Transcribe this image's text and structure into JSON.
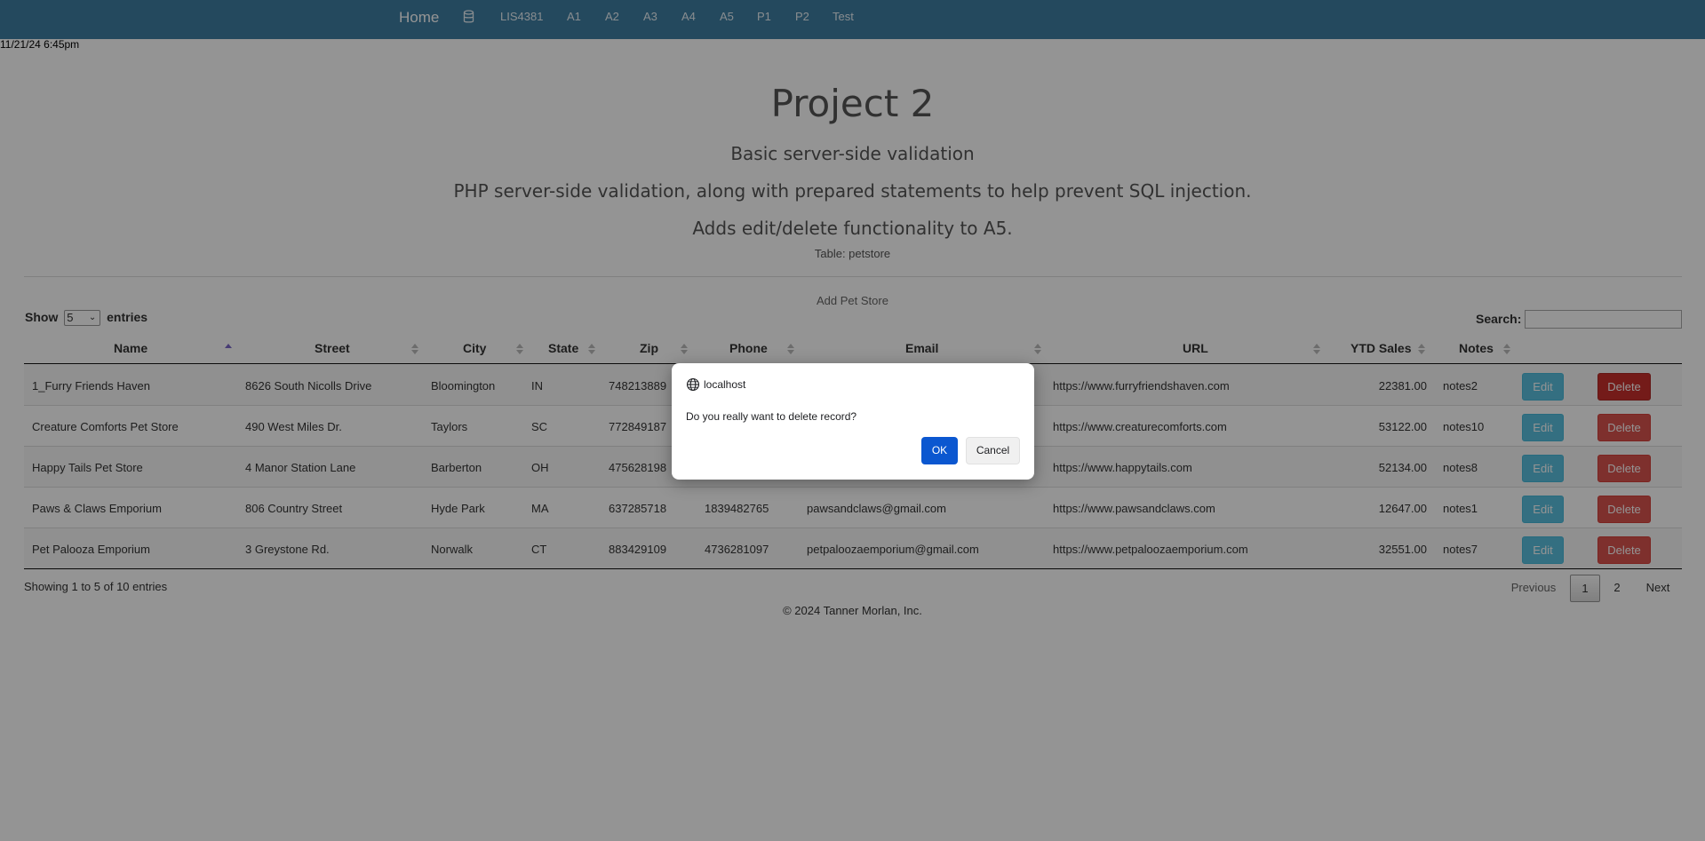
{
  "navbar": {
    "brand": "Home",
    "links": [
      "LIS4381",
      "A1",
      "A2",
      "A3",
      "A4",
      "A5",
      "P1",
      "P2",
      "Test"
    ]
  },
  "timestamp": "11/21/24 6:45pm",
  "header": {
    "title": "Project 2",
    "subtitle1": "Basic server-side validation",
    "subtitle2": "PHP server-side validation, along with prepared statements to help prevent SQL injection.",
    "subtitle3": "Adds edit/delete functionality to A5.",
    "table_name": "Table: petstore"
  },
  "add_link": "Add Pet Store",
  "controls": {
    "show_label": "Show",
    "show_value": "5",
    "entries_label": "entries",
    "search_label": "Search:",
    "search_value": ""
  },
  "table": {
    "columns": [
      "Name",
      "Street",
      "City",
      "State",
      "Zip",
      "Phone",
      "Email",
      "URL",
      "YTD Sales",
      "Notes"
    ],
    "edit_label": "Edit",
    "delete_label": "Delete",
    "rows": [
      {
        "name": "1_Furry Friends Haven",
        "street": "8626 South Nicolls Drive",
        "city": "Bloomington",
        "state": "IN",
        "zip": "748213889",
        "phone": "",
        "email": "",
        "url": "https://www.furryfriendshaven.com",
        "ytd": "22381.00",
        "notes": "notes2"
      },
      {
        "name": "Creature Comforts Pet Store",
        "street": "490 West Miles Dr.",
        "city": "Taylors",
        "state": "SC",
        "zip": "772849187",
        "phone": "",
        "email": "",
        "url": "https://www.creaturecomforts.com",
        "ytd": "53122.00",
        "notes": "notes10"
      },
      {
        "name": "Happy Tails Pet Store",
        "street": "4 Manor Station Lane",
        "city": "Barberton",
        "state": "OH",
        "zip": "475628198",
        "phone": "",
        "email": "",
        "url": "https://www.happytails.com",
        "ytd": "52134.00",
        "notes": "notes8"
      },
      {
        "name": "Paws & Claws Emporium",
        "street": "806 Country Street",
        "city": "Hyde Park",
        "state": "MA",
        "zip": "637285718",
        "phone": "1839482765",
        "email": "pawsandclaws@gmail.com",
        "url": "https://www.pawsandclaws.com",
        "ytd": "12647.00",
        "notes": "notes1"
      },
      {
        "name": "Pet Palooza Emporium",
        "street": "3 Greystone Rd.",
        "city": "Norwalk",
        "state": "CT",
        "zip": "883429109",
        "phone": "4736281097",
        "email": "petpaloozaemporium@gmail.com",
        "url": "https://www.petpaloozaemporium.com",
        "ytd": "32551.00",
        "notes": "notes7"
      }
    ]
  },
  "info": "Showing 1 to 5 of 10 entries",
  "pagination": {
    "previous": "Previous",
    "pages": [
      "1",
      "2"
    ],
    "next": "Next"
  },
  "footer": "© 2024 Tanner Morlan, Inc.",
  "dialog": {
    "origin": "localhost",
    "message": "Do you really want to delete record?",
    "ok": "OK",
    "cancel": "Cancel"
  },
  "colors": {
    "navbar": "#3e7ea3",
    "edit_button": "#5bc0de",
    "delete_button": "#d9534f",
    "dialog_ok": "#0b57d0"
  }
}
